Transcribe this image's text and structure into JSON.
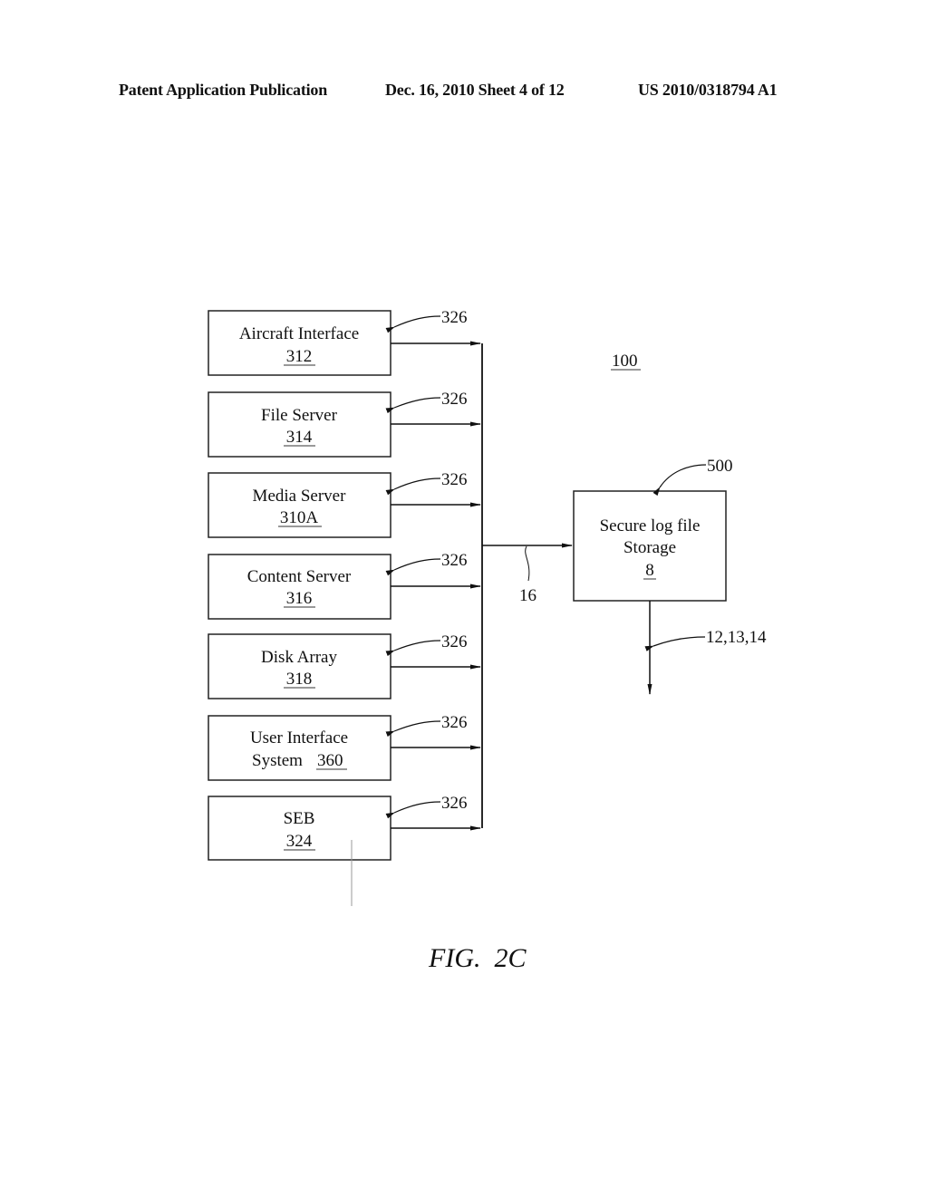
{
  "header": {
    "publication": "Patent Application Publication",
    "date_sheet": "Dec. 16, 2010   Sheet 4 of 12",
    "patent_number": "US 2010/0318794 A1"
  },
  "diagram": {
    "system_ref": "100",
    "components": [
      {
        "name": "Aircraft Interface",
        "ref": "312",
        "arrow_ref": "326"
      },
      {
        "name": "File Server",
        "ref": "314",
        "arrow_ref": "326"
      },
      {
        "name": "Media Server",
        "ref": "310A",
        "arrow_ref": "326"
      },
      {
        "name": "Content Server",
        "ref": "316",
        "arrow_ref": "326"
      },
      {
        "name": "Disk Array",
        "ref": "318",
        "arrow_ref": "326"
      },
      {
        "name_line1": "User Interface",
        "name_line2": "System",
        "ref": "360",
        "arrow_ref": "326"
      },
      {
        "name": "SEB",
        "ref": "324",
        "arrow_ref": "326"
      }
    ],
    "storage": {
      "line1": "Secure log file",
      "line2": "Storage",
      "ref": "8",
      "box_ref": "500",
      "output_ref": "12,13,14"
    },
    "bus_ref": "16"
  },
  "figure_label": "FIG.  2C"
}
